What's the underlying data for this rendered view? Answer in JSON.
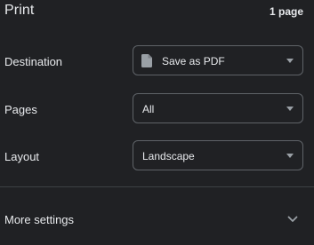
{
  "header": {
    "title": "Print",
    "page_count": "1 page"
  },
  "settings": {
    "destination": {
      "label": "Destination",
      "value": "Save as PDF",
      "icon": "document-icon"
    },
    "pages": {
      "label": "Pages",
      "value": "All"
    },
    "layout": {
      "label": "Layout",
      "value": "Landscape"
    }
  },
  "more_settings": {
    "label": "More settings",
    "icon": "chevron-down-icon"
  },
  "colors": {
    "background": "#202124",
    "text": "#e8eaed",
    "border": "#5f6368",
    "divider": "#3c4043",
    "icon": "#9aa0a6"
  }
}
